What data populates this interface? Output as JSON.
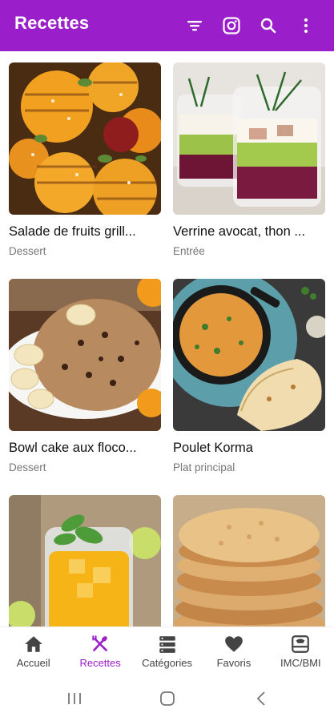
{
  "appbar": {
    "title": "Recettes",
    "background": "#9a1ec9",
    "icons": [
      "filter-icon",
      "instagram-icon",
      "search-icon",
      "more-vert-icon"
    ]
  },
  "recipes": [
    {
      "name": "Salade de fruits grill...",
      "category": "Dessert"
    },
    {
      "name": "Verrine avocat, thon ...",
      "category": "Entrée"
    },
    {
      "name": "Bowl cake aux floco...",
      "category": "Dessert"
    },
    {
      "name": "Poulet Korma",
      "category": "Plat principal"
    },
    {
      "name": "",
      "category": ""
    },
    {
      "name": "",
      "category": ""
    }
  ],
  "bottom_nav": {
    "active_color": "#9a1ec9",
    "items": [
      {
        "label": "Accueil",
        "icon": "home-icon",
        "active": false
      },
      {
        "label": "Recettes",
        "icon": "utensils-icon",
        "active": true
      },
      {
        "label": "Catégories",
        "icon": "categories-icon",
        "active": false
      },
      {
        "label": "Favoris",
        "icon": "heart-icon",
        "active": false
      },
      {
        "label": "IMC/BMI",
        "icon": "scale-icon",
        "active": false
      }
    ]
  },
  "system_nav": {
    "icons": [
      "recents-icon",
      "home-circle-icon",
      "back-icon"
    ]
  }
}
